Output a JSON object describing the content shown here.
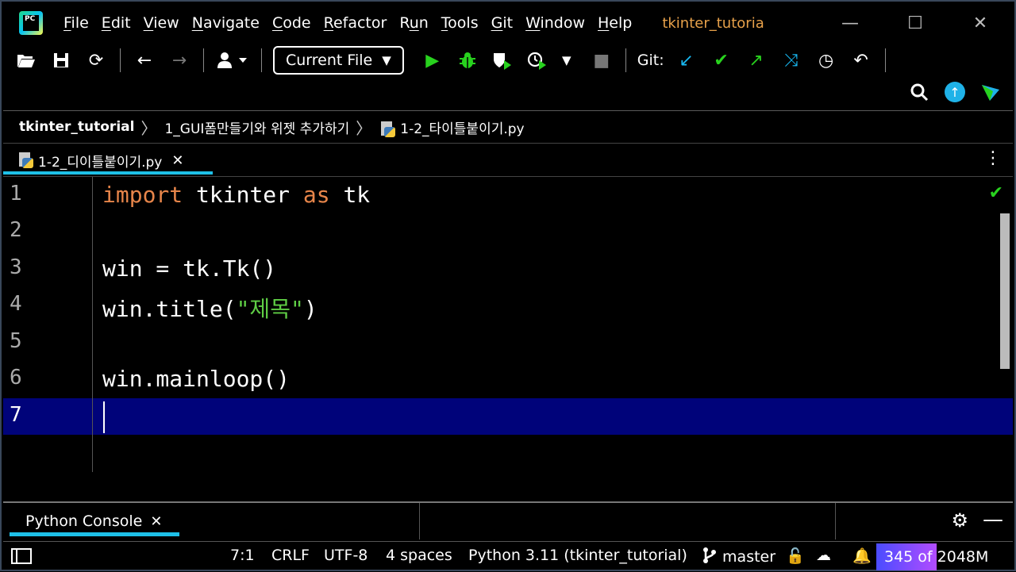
{
  "menu": {
    "items": [
      {
        "u": "F",
        "rest": "ile"
      },
      {
        "u": "E",
        "rest": "dit"
      },
      {
        "u": "V",
        "rest": "iew"
      },
      {
        "u": "N",
        "rest": "avigate"
      },
      {
        "u": "C",
        "rest": "ode"
      },
      {
        "u": "R",
        "rest": "efactor"
      },
      {
        "pre": "R",
        "u": "u",
        "rest": "n"
      },
      {
        "u": "T",
        "rest": "ools"
      },
      {
        "u": "G",
        "rest": "it"
      },
      {
        "u": "W",
        "rest": "indow"
      },
      {
        "u": "H",
        "rest": "elp"
      }
    ],
    "project_title": "tkinter_tutoria",
    "logo_text": "PC"
  },
  "toolbar": {
    "run_config": "Current File",
    "git_label": "Git:"
  },
  "breadcrumb": {
    "project": "tkinter_tutorial",
    "folder": "1_GUI폼만들기와 위젯 추가하기",
    "file": "1-2_타이틀붙이기.py"
  },
  "tab": {
    "label": "1-2_디이틀붙이기.py"
  },
  "editor": {
    "lines": [
      {
        "n": "1"
      },
      {
        "n": "2"
      },
      {
        "n": "3"
      },
      {
        "n": "4"
      },
      {
        "n": "5"
      },
      {
        "n": "6"
      },
      {
        "n": "7"
      }
    ],
    "code": {
      "l1_kw": "import",
      "l1_mid": " tkinter ",
      "l1_kw2": "as",
      "l1_end": " tk",
      "l3": "win = tk.Tk()",
      "l4_pre": "win.title(",
      "l4_str": "\"제목\"",
      "l4_post": ")",
      "l6": "win.mainloop()"
    }
  },
  "toolwindow": {
    "console_tab": "Python Console"
  },
  "status": {
    "position": "7:1",
    "line_sep": "CRLF",
    "encoding": "UTF-8",
    "indent": "4 spaces",
    "interpreter": "Python 3.11 (tkinter_tutorial)",
    "branch": "master",
    "memory": "345 of 2048M"
  },
  "colors": {
    "keyword": "#e7854a",
    "string": "#5fce45",
    "current_line": "#00037a",
    "accent": "#1ec0e8",
    "project_title": "#e7a14a"
  }
}
